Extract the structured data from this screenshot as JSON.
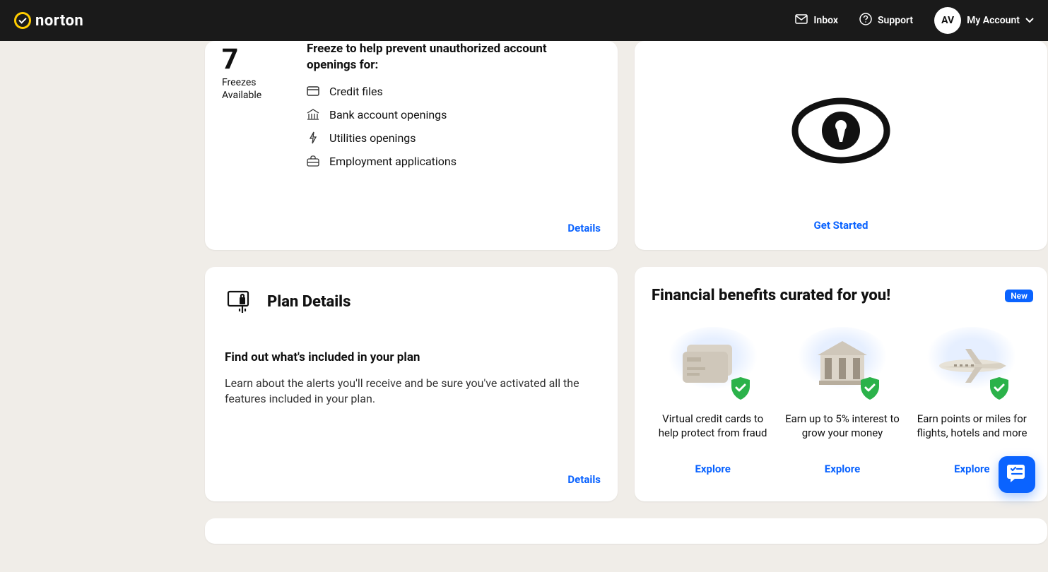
{
  "header": {
    "brand": "norton",
    "inbox_label": "Inbox",
    "support_label": "Support",
    "avatar_initials": "AV",
    "account_label": "My Account"
  },
  "freezes_card": {
    "count": "7",
    "count_label_1": "Freezes",
    "count_label_2": "Available",
    "heading": "Freeze to help prevent unauthorized account openings for:",
    "items": [
      {
        "icon": "card-icon",
        "label": "Credit files"
      },
      {
        "icon": "bank-icon",
        "label": "Bank account openings"
      },
      {
        "icon": "bolt-icon",
        "label": "Utilities openings"
      },
      {
        "icon": "briefcase-icon",
        "label": "Employment applications"
      }
    ],
    "action": "Details"
  },
  "getstarted_card": {
    "action": "Get Started"
  },
  "plan_card": {
    "title": "Plan Details",
    "subhead": "Find out what's included in your plan",
    "copy": "Learn about the alerts you'll receive and be sure you've activated all the features included in your plan.",
    "action": "Details"
  },
  "benefits_card": {
    "title": "Financial benefits curated for you!",
    "badge": "New",
    "items": [
      {
        "text": "Virtual credit cards to help protect from fraud",
        "action": "Explore"
      },
      {
        "text": "Earn up to 5% interest to grow your money",
        "action": "Explore"
      },
      {
        "text": "Earn points or miles for flights, hotels and more",
        "action": "Explore"
      }
    ]
  },
  "colors": {
    "accent": "#0a63ff",
    "brand_yellow": "#ffcc00",
    "badge_green": "#2bb24a"
  }
}
